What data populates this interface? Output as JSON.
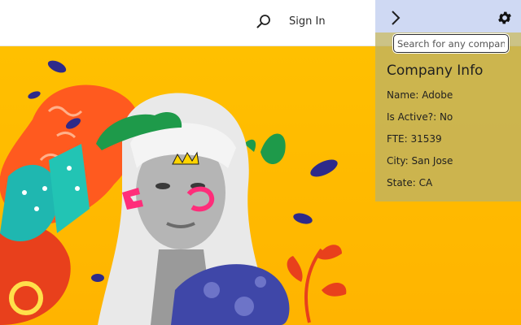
{
  "header": {
    "search_icon": "search-icon",
    "signin_label": "Sign In"
  },
  "hero": {
    "description_colors": {
      "background": "#ffc000",
      "orange_blob": "#ff5a1f",
      "green_crown": "#1e9a4a",
      "teal_leaves": "#1fb7b0",
      "navy_accents": "#2e2a8a",
      "red_leaves": "#e8401c"
    }
  },
  "panel": {
    "collapse_icon": "chevron-right-icon",
    "settings_icon": "gear-icon",
    "search_placeholder": "Search for any company",
    "title": "Company Info",
    "rows": [
      {
        "label": "Name:",
        "value": "Adobe"
      },
      {
        "label": "Is Active?:",
        "value": "No"
      },
      {
        "label": "FTE:",
        "value": "31539"
      },
      {
        "label": "City:",
        "value": "San Jose"
      },
      {
        "label": "State:",
        "value": "CA"
      }
    ],
    "colors": {
      "top_bar": "#cfd9f3",
      "body": "#beb264"
    }
  }
}
